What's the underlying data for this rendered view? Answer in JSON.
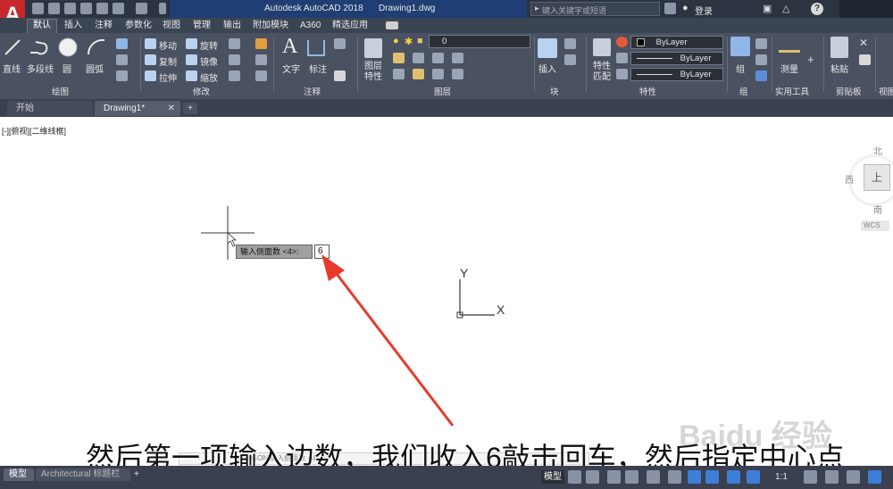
{
  "titlebar": {
    "app_logo": "A",
    "app_title": "Autodesk AutoCAD 2018",
    "file_name": "Drawing1.dwg",
    "search_placeholder": "键入关键字或短语",
    "login": "登录",
    "help": "?"
  },
  "ribbon_tabs": [
    "默认",
    "插入",
    "注释",
    "参数化",
    "视图",
    "管理",
    "输出",
    "附加模块",
    "A360",
    "精选应用"
  ],
  "ribbon": {
    "draw": {
      "line": "直线",
      "polyline": "多段线",
      "circle": "圆",
      "arc": "圆弧",
      "label": "绘图"
    },
    "modify": {
      "move": "移动",
      "rotate": "旋转",
      "copy": "复制",
      "mirror": "镜像",
      "stretch": "拉伸",
      "scale": "缩放",
      "label": "修改"
    },
    "annotation": {
      "text": "文字",
      "dimension": "标注",
      "label": "注释"
    },
    "layers": {
      "properties": "图层特性",
      "current_layer": "0",
      "label": "图层"
    },
    "block": {
      "insert": "插入",
      "label": "块"
    },
    "properties": {
      "match": "特性匹配",
      "color": "ByLayer",
      "linetype": "ByLayer",
      "lineweight": "ByLayer",
      "label": "特性"
    },
    "groups": {
      "group": "组",
      "label": "组"
    },
    "utilities": {
      "measure": "测量",
      "label": "实用工具"
    },
    "clipboard": {
      "paste": "粘贴",
      "label": "剪贴板"
    },
    "view": {
      "label": "视图"
    }
  },
  "doc_tabs": {
    "start": "开始",
    "drawing": "Drawing1*",
    "add": "+"
  },
  "viewport": {
    "label": "[-][俯视][二维线框]",
    "viewcube": {
      "north": "北",
      "west": "西",
      "top": "上",
      "south": "南",
      "wcs": "WCS"
    },
    "ucs": {
      "x": "X",
      "y": "Y"
    },
    "dynamic_prompt": "输入侧面数 <4>:",
    "dynamic_value": "6"
  },
  "caption": "然后第一项输入边数，我们收入6敲击回车，然后指定中心点",
  "watermark": "Baidu 经验",
  "command_line": "POLYGON 输入侧面数 <4>:",
  "layout_tabs": [
    "模型",
    "Architectural 标题栏",
    "+"
  ],
  "statusbar": {
    "model": "模型",
    "scale": "1:1"
  },
  "colors": {
    "annotation_arrow": "#e8392c",
    "title_bg": "#2b3440",
    "ribbon_bg": "#4a5160",
    "logo_red": "#c8282c"
  }
}
